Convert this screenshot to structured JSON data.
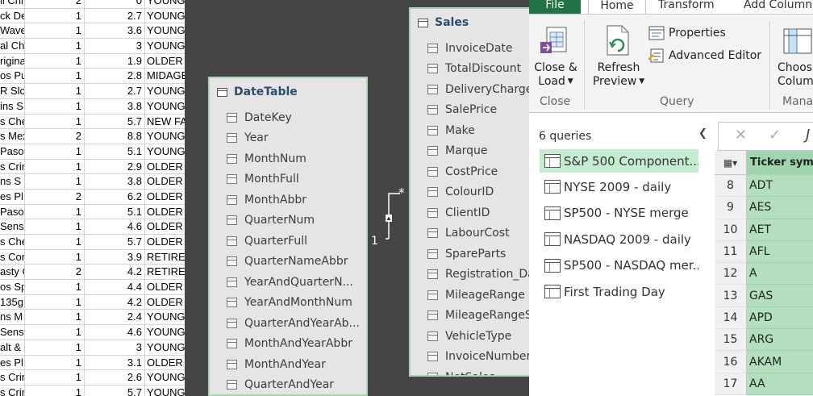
{
  "sheet": {
    "rows": [
      {
        "name": "ll Chr",
        "a": "2",
        "b": "0",
        "c": "YOUNG"
      },
      {
        "name": "ck De",
        "a": "1",
        "b": "2.7",
        "c": "YOUNG"
      },
      {
        "name": "Wave",
        "a": "1",
        "b": "3.6",
        "c": "YOUNG"
      },
      {
        "name": "al Chi",
        "a": "1",
        "b": "3",
        "c": "YOUNG"
      },
      {
        "name": "rigina",
        "a": "1",
        "b": "1.9",
        "c": "OLDER"
      },
      {
        "name": "os Pu",
        "a": "1",
        "b": "2.8",
        "c": "MIDAGE"
      },
      {
        "name": "R Slov",
        "a": "1",
        "b": "2.7",
        "c": "YOUNG"
      },
      {
        "name": "ins S",
        "a": "1",
        "b": "3.8",
        "c": "YOUNG"
      },
      {
        "name": "s Che",
        "a": "1",
        "b": "5.7",
        "c": "NEW FA"
      },
      {
        "name": "s Mex",
        "a": "2",
        "b": "8.8",
        "c": "YOUNG"
      },
      {
        "name": "Paso",
        "a": "1",
        "b": "5.1",
        "c": "YOUNG"
      },
      {
        "name": "s Crin",
        "a": "1",
        "b": "2.9",
        "c": "OLDER"
      },
      {
        "name": "ns S",
        "a": "1",
        "b": "3.8",
        "c": "OLDER"
      },
      {
        "name": "es Pl",
        "a": "2",
        "b": "6.2",
        "c": "OLDER"
      },
      {
        "name": "Paso",
        "a": "1",
        "b": "5.1",
        "c": "OLDER"
      },
      {
        "name": "Sens",
        "a": "1",
        "b": "4.6",
        "c": "OLDER"
      },
      {
        "name": "s Che",
        "a": "1",
        "b": "5.7",
        "c": "OLDER"
      },
      {
        "name": "s Cor",
        "a": "1",
        "b": "3.9",
        "c": "RETIRE"
      },
      {
        "name": "asty C",
        "a": "2",
        "b": "4.2",
        "c": "RETIRE"
      },
      {
        "name": "os Sp",
        "a": "1",
        "b": "4.4",
        "c": "OLDER"
      },
      {
        "name": "135g",
        "a": "1",
        "b": "4.2",
        "c": "OLDER"
      },
      {
        "name": "ns M",
        "a": "1",
        "b": "2.4",
        "c": "YOUNG"
      },
      {
        "name": "Sens",
        "a": "1",
        "b": "4.6",
        "c": "YOUNG"
      },
      {
        "name": "alt & V",
        "a": "1",
        "b": "3",
        "c": "YOUNG"
      },
      {
        "name": "es Pl",
        "a": "1",
        "b": "3.1",
        "c": "OLDER"
      },
      {
        "name": "s Crin",
        "a": "1",
        "b": "2.6",
        "c": "YOUNG"
      },
      {
        "name": "s Crin",
        "a": "1",
        "b": "5.7",
        "c": "YOUNG"
      }
    ]
  },
  "diagram": {
    "date_table": {
      "title": "DateTable",
      "fields": [
        "DateKey",
        "Year",
        "MonthNum",
        "MonthFull",
        "MonthAbbr",
        "QuarterNum",
        "QuarterFull",
        "QuarterNameAbbr",
        "YearAndQuarterN...",
        "YearAndMonthNum",
        "QuarterAndYearAb...",
        "MonthAndYearAbbr",
        "MonthAndYear",
        "QuarterAndYear"
      ]
    },
    "sales_table": {
      "title": "Sales",
      "fields": [
        "InvoiceDate",
        "TotalDiscount",
        "DeliveryCharge",
        "SalePrice",
        "Make",
        "Marque",
        "CostPrice",
        "ColourID",
        "ClientID",
        "LabourCost",
        "SpareParts",
        "Registration_Da",
        "MileageRange",
        "MileageRangeSo",
        "VehicleType",
        "InvoiceNumber",
        "NetSales"
      ]
    },
    "relationship": {
      "one": "1",
      "many": "*"
    }
  },
  "power_query": {
    "tabs": {
      "file": "File",
      "home": "Home",
      "transform": "Transform",
      "add_column": "Add Column"
    },
    "ribbon": {
      "close_load": "Close &",
      "close_load2": "Load",
      "refresh": "Refresh",
      "refresh2": "Preview",
      "properties": "Properties",
      "advanced_editor": "Advanced Editor",
      "choose": "Choos",
      "choose2": "Column",
      "group_close": "Close",
      "group_query": "Query",
      "group_manage": "Mana"
    },
    "queries_count": "6 queries",
    "queries": [
      "S&P 500 Component...",
      "NYSE 2009 - daily",
      "SP500 - NYSE merge",
      "NASDAQ 2009 - daily",
      "SP500 - NASDAQ mer...",
      "First Trading Day"
    ],
    "selected_query_index": 0,
    "formula_bar": {
      "cancel": "✕",
      "confirm": "✓",
      "fx": "J"
    },
    "grid": {
      "column_header": "Ticker symbol",
      "rows": [
        {
          "num": "8",
          "value": "ADT"
        },
        {
          "num": "9",
          "value": "AES"
        },
        {
          "num": "10",
          "value": "AET"
        },
        {
          "num": "11",
          "value": "AFL"
        },
        {
          "num": "12",
          "value": "A"
        },
        {
          "num": "13",
          "value": "GAS"
        },
        {
          "num": "14",
          "value": "APD"
        },
        {
          "num": "15",
          "value": "ARG"
        },
        {
          "num": "16",
          "value": "AKAM"
        },
        {
          "num": "17",
          "value": "AA"
        }
      ]
    },
    "colors": {
      "accent": "#217346",
      "selected_query": "#c6ecd0",
      "grid_fill": "#b3dfbf"
    }
  }
}
